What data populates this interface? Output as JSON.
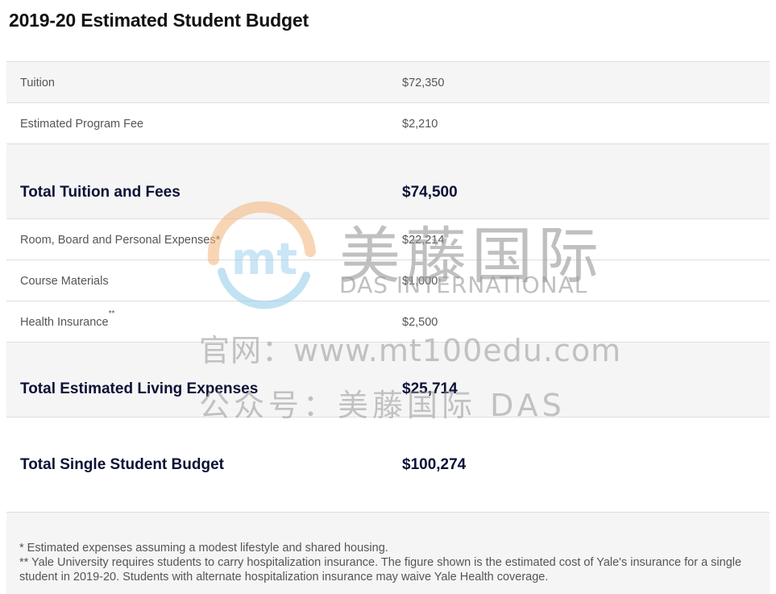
{
  "title": "2019-20 Estimated Student Budget",
  "rows": [
    {
      "label": "Tuition",
      "value": "$72,350"
    },
    {
      "label": "Estimated Program Fee",
      "value": "$2,210"
    },
    {
      "label": "Total Tuition and Fees",
      "value": "$74,500"
    },
    {
      "label": "Room, Board and Personal Expenses*",
      "value": "$22,214"
    },
    {
      "label": "Course Materials",
      "value": "$1,000"
    },
    {
      "label": "Health Insurance",
      "marker": "**",
      "value": "$2,500"
    },
    {
      "label": "Total Estimated Living Expenses",
      "value": "$25,714"
    },
    {
      "label": "Total Single Student Budget",
      "value": "$100,274"
    }
  ],
  "notes": [
    "* Estimated expenses assuming a modest lifestyle and shared housing.",
    "** Yale University requires students to carry hospitalization insurance. The figure shown is the estimated cost of Yale's insurance for a single student in 2019-20. Students with alternate hospitalization insurance may waive Yale Health coverage."
  ],
  "watermark": {
    "logo_text": "mt",
    "brand_cn": "美藤国际",
    "brand_en": "DAS INTERNATIONAL",
    "website": "官网：www.mt100edu.com",
    "wechat": "公众号：美藤国际 DAS"
  }
}
